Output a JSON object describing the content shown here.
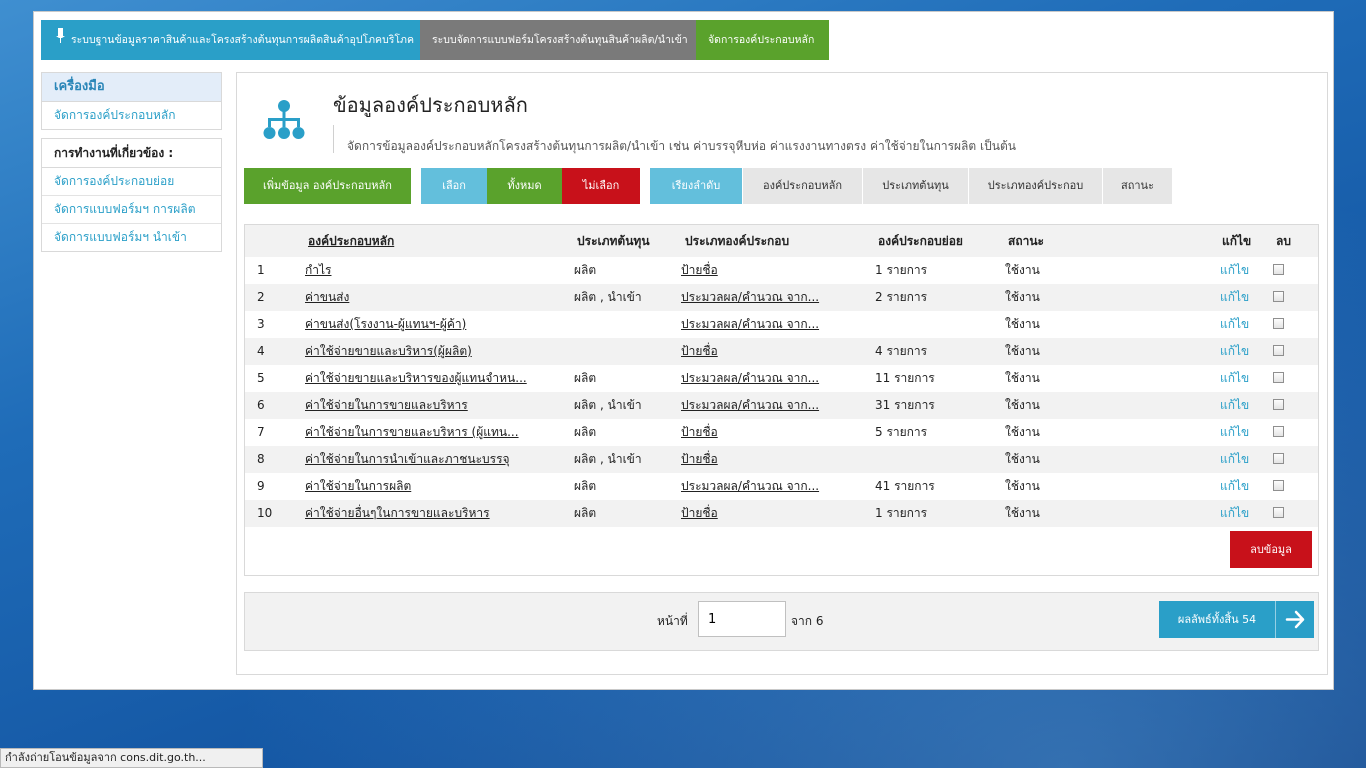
{
  "topnav": {
    "tabs": [
      {
        "label": "ระบบฐานข้อมูลราคาสินค้าและโครงสร้างต้นทุนการผลิตสินค้าอุปโภคบริโภค",
        "color": "#2a9fc8"
      },
      {
        "label": "ระบบจัดการแบบฟอร์มโครงสร้างต้นทุนสินค้าผลิต/นำเข้า",
        "color": "#7a7a7a"
      },
      {
        "label": "จัดการองค์ประกอบหลัก",
        "color": "#5aa22c"
      }
    ]
  },
  "sidebar": {
    "tools_heading": "เครื่องมือ",
    "tools_items": [
      "จัดการองค์ประกอบหลัก"
    ],
    "related_heading": "การทำงานที่เกี่ยวข้อง :",
    "related_items": [
      "จัดการองค์ประกอบย่อย",
      "จัดการแบบฟอร์มฯ การผลิต",
      "จัดการแบบฟอร์มฯ นำเข้า"
    ]
  },
  "header": {
    "icon": "hierarchy-icon",
    "title": "ข้อมูลองค์ประกอบหลัก",
    "description": "จัดการข้อมูลองค์ประกอบหลักโครงสร้างต้นทุนการผลิต/นำเข้า เช่น ค่าบรรจุหีบห่อ ค่าแรงงานทางตรง ค่าใช้จ่ายในการผลิต เป็นต้น"
  },
  "actions": {
    "add_label": "เพิ่มข้อมูล องค์ประกอบหลัก",
    "select_label": "เลือก",
    "all_label": "ทั้งหมด",
    "none_label": "ไม่เลือก",
    "sort_label": "เรียงลำดับ",
    "sort_options": [
      "องค์ประกอบหลัก",
      "ประเภทต้นทุน",
      "ประเภทองค์ประกอบ",
      "สถานะ"
    ]
  },
  "table": {
    "headers": {
      "name": "องค์ประกอบหลัก",
      "cost_type": "ประเภทต้นทุน",
      "comp_type": "ประเภทองค์ประกอบ",
      "sub": "องค์ประกอบย่อย",
      "status": "สถานะ",
      "edit": "แก้ไข",
      "delete": "ลบ"
    },
    "rows": [
      {
        "no": "1",
        "name": "กำไร",
        "cost_type": "ผลิต",
        "comp_type": "ป้ายชื่อ",
        "sub": "1 รายการ",
        "status": "ใช้งาน",
        "edit": "แก้ไข"
      },
      {
        "no": "2",
        "name": "ค่าขนส่ง",
        "cost_type": "ผลิต , นำเข้า",
        "comp_type": "ประมวลผล/คำนวณ จาก...",
        "sub": "2 รายการ",
        "status": "ใช้งาน",
        "edit": "แก้ไข"
      },
      {
        "no": "3",
        "name": "ค่าขนส่ง(โรงงาน-ผู้แทนฯ-ผู้ค้า)",
        "cost_type": "",
        "comp_type": "ประมวลผล/คำนวณ จาก...",
        "sub": "",
        "status": "ใช้งาน",
        "edit": "แก้ไข"
      },
      {
        "no": "4",
        "name": "ค่าใช้จ่ายขายและบริหาร(ผู้ผลิต)",
        "cost_type": "",
        "comp_type": "ป้ายชื่อ",
        "sub": "4 รายการ",
        "status": "ใช้งาน",
        "edit": "แก้ไข"
      },
      {
        "no": "5",
        "name": "ค่าใช้จ่ายขายและบริหารของผู้แทนจำหน...",
        "cost_type": "ผลิต",
        "comp_type": "ประมวลผล/คำนวณ จาก...",
        "sub": "11 รายการ",
        "status": "ใช้งาน",
        "edit": "แก้ไข"
      },
      {
        "no": "6",
        "name": "ค่าใช้จ่ายในการขายและบริหาร",
        "cost_type": "ผลิต , นำเข้า",
        "comp_type": "ประมวลผล/คำนวณ จาก...",
        "sub": "31 รายการ",
        "status": "ใช้งาน",
        "edit": "แก้ไข"
      },
      {
        "no": "7",
        "name": "ค่าใช้จ่ายในการขายและบริหาร (ผู้แทน...",
        "cost_type": "ผลิต",
        "comp_type": "ป้ายชื่อ",
        "sub": "5 รายการ",
        "status": "ใช้งาน",
        "edit": "แก้ไข"
      },
      {
        "no": "8",
        "name": "ค่าใช้จ่ายในการนำเข้าและภาชนะบรรจุ",
        "cost_type": "ผลิต , นำเข้า",
        "comp_type": "ป้ายชื่อ",
        "sub": "",
        "status": "ใช้งาน",
        "edit": "แก้ไข"
      },
      {
        "no": "9",
        "name": "ค่าใช้จ่ายในการผลิต",
        "cost_type": "ผลิต",
        "comp_type": "ประมวลผล/คำนวณ จาก...",
        "sub": "41 รายการ",
        "status": "ใช้งาน",
        "edit": "แก้ไข"
      },
      {
        "no": "10",
        "name": "ค่าใช้จ่ายอื่นๆในการขายและบริหาร",
        "cost_type": "ผลิต",
        "comp_type": "ป้ายชื่อ",
        "sub": "1 รายการ",
        "status": "ใช้งาน",
        "edit": "แก้ไข"
      }
    ],
    "delete_button": "ลบข้อมูล"
  },
  "pagination": {
    "page_label": "หน้าที่",
    "current_page": "1",
    "of_label": "จาก 6",
    "total_label": "ผลลัพธ์ทั้งสิ้น 54",
    "next_icon": "arrow-right-icon"
  },
  "statusbar": {
    "text": "กำลังถ่ายโอนข้อมูลจาก cons.dit.go.th..."
  }
}
